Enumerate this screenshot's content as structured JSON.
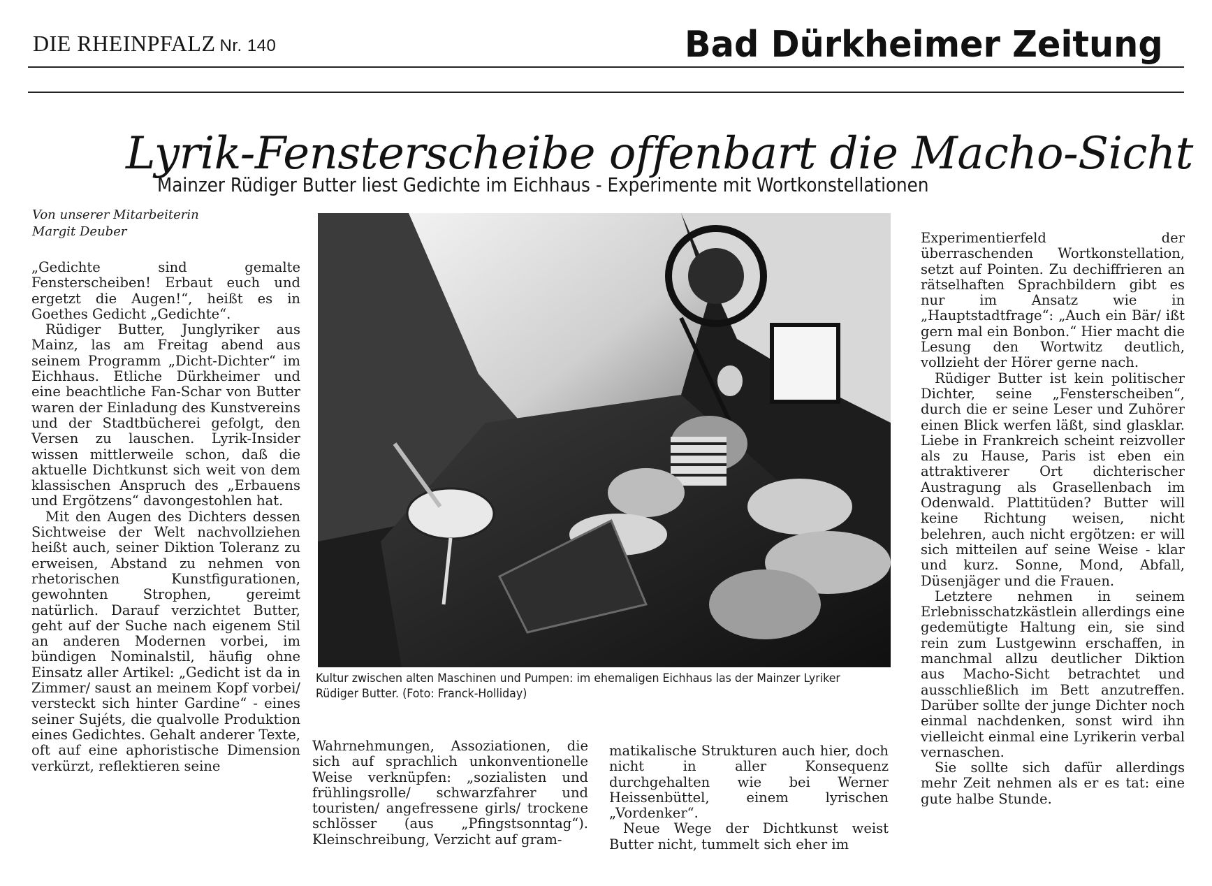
{
  "masthead": {
    "paper": "DIE RHEINPFALZ",
    "issue": "Nr. 140",
    "section": "Bad Dürkheimer Zeitung"
  },
  "article": {
    "headline": "Lyrik-Fensterscheibe offenbart die Macho-Sicht",
    "subheadline": "Mainzer Rüdiger Butter liest Gedichte im Eichhaus - Experimente mit Wortkonstellationen",
    "byline_line1": "Von unserer Mitarbeiterin",
    "byline_line2": "Margit Deuber",
    "col1_p1": "„Gedichte sind gemalte Fensterscheiben! Erbaut euch und ergetzt die Augen!“, heißt es in Goethes Gedicht „Gedichte“.",
    "col1_p2": "Rüdiger Butter, Junglyriker aus Mainz, las am Freitag abend aus seinem Programm „Dicht-Dichter“ im Eichhaus. Etliche Dürkheimer und eine beachtliche Fan-Schar von Butter waren der Einladung des Kunstvereins und der Stadtbücherei gefolgt, den Versen zu lauschen. Lyrik-Insider wissen mittlerweile schon, daß die aktuelle Dichtkunst sich weit von dem klassischen Anspruch des „Erbauens und Ergötzens“ davongestohlen hat.",
    "col1_p3": "Mit den Augen des Dichters dessen Sichtweise der Welt nachvollziehen heißt auch, seiner Diktion Toleranz zu erweisen, Abstand zu nehmen von rhetorischen Kunstfigurationen, gewohnten Strophen, gereimt natürlich. Darauf verzichtet Butter, geht auf der Suche nach eigenem Stil an anderen Modernen vorbei, im bündigen Nominalstil, häufig ohne Einsatz aller Artikel: „Gedicht ist da in Zimmer/ saust an meinem Kopf vorbei/ versteckt sich hinter Gardine“ - eines seiner Sujéts, die qualvolle Produktion eines Gedichtes. Gehalt anderer Texte, oft auf eine aphoristische Dimension verkürzt, reflektieren seine",
    "col2_p1": "Wahrnehmungen, Assoziationen, die sich auf sprachlich unkonventionelle Weise verknüpfen: „sozialisten und frühlingsrolle/ schwarzfahrer und touristen/ angefressene girls/ trockene schlösser (aus „Pfingstsonntag“). Kleinschreibung, Verzicht auf gram-",
    "col3_p1": "matikalische Strukturen auch hier, doch nicht in aller Konsequenz durchgehalten wie bei Werner Heissenbüttel, einem lyrischen „Vordenker“.",
    "col3_p2": "Neue Wege der Dichtkunst weist Butter nicht, tummelt sich eher im",
    "col4_p1": "Experimentierfeld der überraschenden Wortkonstellation, setzt auf Pointen. Zu dechiffrieren an rätselhaften Sprachbildern gibt es nur im Ansatz wie in „Hauptstadtfrage“: „Auch ein Bär/ ißt gern mal ein Bonbon.“ Hier macht die Lesung den Wortwitz deutlich, vollzieht der Hörer gerne nach.",
    "col4_p2": "Rüdiger Butter ist kein politischer Dichter, seine „Fensterscheiben“, durch die er seine Leser und Zuhörer einen Blick werfen läßt, sind glasklar. Liebe in Frankreich scheint reizvoller als zu Hause, Paris ist eben ein attraktiverer Ort dichterischer Austragung als Grasellenbach im Odenwald. Plattitüden? Butter will keine Richtung weisen, nicht belehren, auch nicht ergötzen: er will sich mitteilen auf seine Weise - klar und kurz. Sonne, Mond, Abfall, Düsenjäger und die Frauen.",
    "col4_p3": "Letztere nehmen in seinem Erlebnisschatzkästlein allerdings eine gedemütigte Haltung ein, sie sind rein zum Lustgewinn erschaffen, in manchmal allzu deutlicher Diktion aus Macho-Sicht betrachtet und ausschließlich im Bett anzutreffen. Darüber sollte der junge Dichter noch einmal nachdenken, sonst wird ihn vielleicht einmal eine Lyrikerin verbal vernaschen.",
    "col4_p4": "Sie sollte sich dafür allerdings mehr Zeit nehmen als er es tat: eine gute halbe Stunde.",
    "caption": "Kultur zwischen alten Maschinen und Pumpen: im ehemaligen Eichhaus las der Mainzer Lyriker Rüdiger Butter. (Foto: Franck-Holliday)"
  }
}
